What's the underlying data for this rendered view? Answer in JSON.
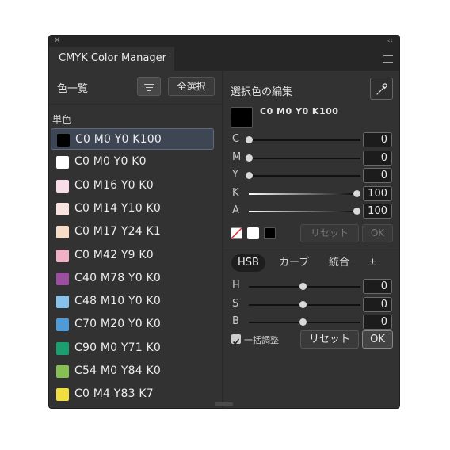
{
  "window": {
    "title": "CMYK Color Manager"
  },
  "left": {
    "list_title": "色一覧",
    "select_all": "全選択",
    "section": "単色",
    "items": [
      {
        "label": "C0 M0 Y0 K100",
        "color": "#000000",
        "selected": true
      },
      {
        "label": "C0 M0 Y0 K0",
        "color": "#ffffff"
      },
      {
        "label": "C0 M16 Y0 K0",
        "color": "#f8dde9"
      },
      {
        "label": "C0 M14 Y10 K0",
        "color": "#f9e3e1"
      },
      {
        "label": "C0 M17 Y24 K1",
        "color": "#f5ddc8"
      },
      {
        "label": "C0 M42 Y9 K0",
        "color": "#eeb1c6"
      },
      {
        "label": "C40 M78 Y0 K0",
        "color": "#9c4f9f"
      },
      {
        "label": "C48 M10 Y0 K0",
        "color": "#88c2ea"
      },
      {
        "label": "C70 M20 Y0 K0",
        "color": "#4f9bd7"
      },
      {
        "label": "C90 M0 Y71 K0",
        "color": "#1a9f71"
      },
      {
        "label": "C54 M0 Y84 K0",
        "color": "#87c052"
      },
      {
        "label": "C0 M4 Y83 K7",
        "color": "#f0dc43"
      }
    ]
  },
  "editor": {
    "title": "選択色の編集",
    "current_label": "C0 M0 Y0 K100",
    "current_color": "#000000",
    "sliders": [
      {
        "label": "C",
        "value": "0",
        "fraction": 0
      },
      {
        "label": "M",
        "value": "0",
        "fraction": 0
      },
      {
        "label": "Y",
        "value": "0",
        "fraction": 0
      },
      {
        "label": "K",
        "value": "100",
        "fraction": 1
      },
      {
        "label": "A",
        "value": "100",
        "fraction": 1
      }
    ],
    "reset_label": "リセット",
    "ok_label": "OK"
  },
  "mode": {
    "tabs": [
      "HSB",
      "カーブ",
      "統合",
      "±"
    ],
    "active": "HSB",
    "sliders": [
      {
        "label": "H",
        "value": "0",
        "fraction": 0.5
      },
      {
        "label": "S",
        "value": "0",
        "fraction": 0.5
      },
      {
        "label": "B",
        "value": "0",
        "fraction": 0.5
      }
    ],
    "bulk_label": "一括調整",
    "bulk_checked": true,
    "reset_label": "リセット",
    "ok_label": "OK"
  }
}
